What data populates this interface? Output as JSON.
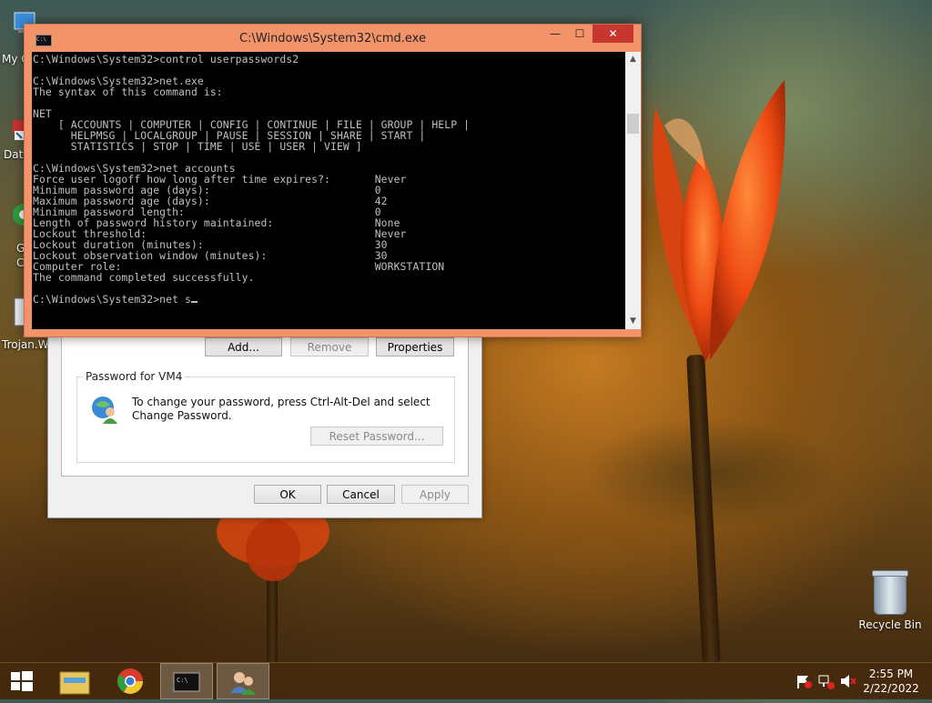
{
  "desktop": {
    "left_icons": [
      "My C",
      "Data",
      "G",
      "C",
      "Trojan.Wi"
    ],
    "recycle_bin_label": "Recycle Bin"
  },
  "cmd_window": {
    "title": "C:\\Windows\\System32\\cmd.exe",
    "controls": {
      "minimize": "—",
      "maximize": "☐",
      "close": "✕"
    },
    "lines": [
      "C:\\Windows\\System32>control userpasswords2",
      "",
      "C:\\Windows\\System32>net.exe",
      "The syntax of this command is:",
      "",
      "NET",
      "    [ ACCOUNTS | COMPUTER | CONFIG | CONTINUE | FILE | GROUP | HELP |",
      "      HELPMSG | LOCALGROUP | PAUSE | SESSION | SHARE | START |",
      "      STATISTICS | STOP | TIME | USE | USER | VIEW ]",
      "",
      "C:\\Windows\\System32>net accounts",
      "Force user logoff how long after time expires?:       Never",
      "Minimum password age (days):                          0",
      "Maximum password age (days):                          42",
      "Minimum password length:                              0",
      "Length of password history maintained:                None",
      "Lockout threshold:                                    Never",
      "Lockout duration (minutes):                           30",
      "Lockout observation window (minutes):                 30",
      "Computer role:                                        WORKSTATION",
      "The command completed successfully.",
      "",
      "C:\\Windows\\System32>net s"
    ],
    "scroll_up": "▲",
    "scroll_down": "▼"
  },
  "dialog": {
    "add_button": "Add...",
    "remove_button": "Remove",
    "properties_button": "Properties",
    "group_title": "Password for VM4",
    "message": "To change your password, press Ctrl-Alt-Del and select Change Password.",
    "reset_button": "Reset Password...",
    "ok_button": "OK",
    "cancel_button": "Cancel",
    "apply_button": "Apply"
  },
  "taskbar": {
    "clock_time": "2:55 PM",
    "clock_date": "2/22/2022"
  }
}
